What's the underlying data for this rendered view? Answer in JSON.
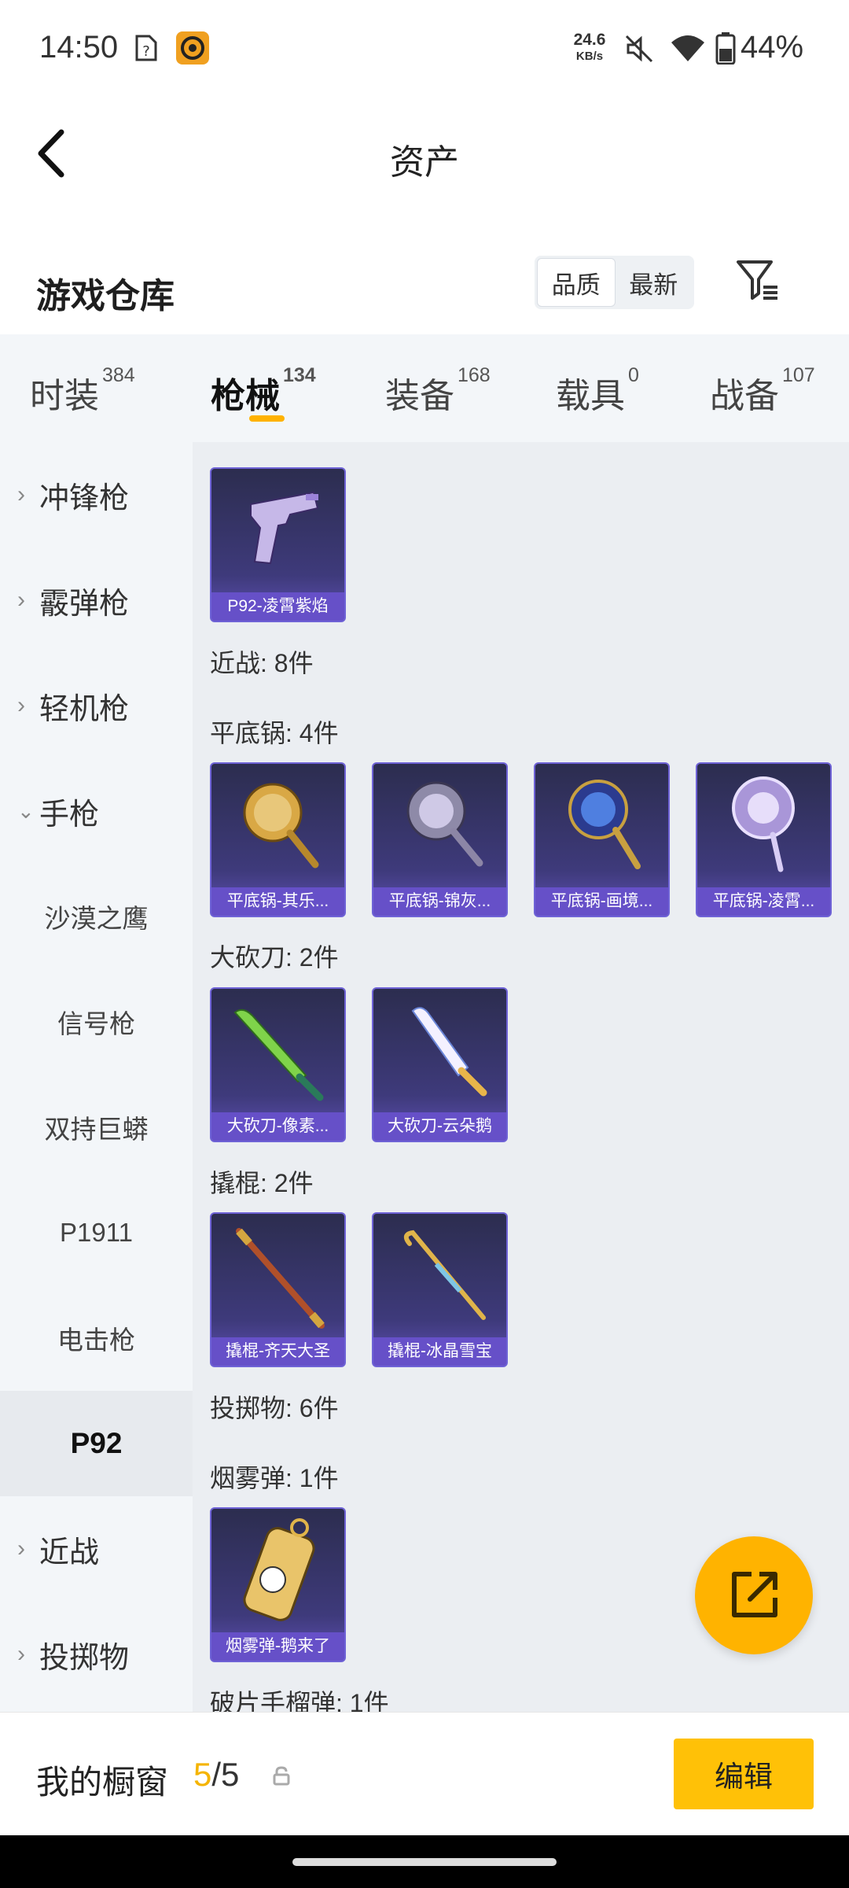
{
  "status_bar": {
    "time": "14:50",
    "net_speed_value": "24.6",
    "net_speed_unit": "KB/s",
    "battery": "44%",
    "icons": [
      "sim-question-icon",
      "app-notification-icon",
      "mute-icon",
      "wifi-icon",
      "battery-icon"
    ]
  },
  "header": {
    "title": "资产"
  },
  "warehouse": {
    "title": "游戏仓库",
    "sort_quality": "品质",
    "sort_latest": "最新"
  },
  "tabs": [
    {
      "label": "时装",
      "count": "384"
    },
    {
      "label": "枪械",
      "count": "134",
      "active": true
    },
    {
      "label": "装备",
      "count": "168"
    },
    {
      "label": "载具",
      "count": "0"
    },
    {
      "label": "战备",
      "count": "107"
    }
  ],
  "sidebar": [
    {
      "label": "冲锋枪",
      "type": "group",
      "expanded": false
    },
    {
      "label": "霰弹枪",
      "type": "group",
      "expanded": false
    },
    {
      "label": "轻机枪",
      "type": "group",
      "expanded": false
    },
    {
      "label": "手枪",
      "type": "group",
      "expanded": true
    },
    {
      "label": "沙漠之鹰",
      "type": "sub"
    },
    {
      "label": "信号枪",
      "type": "sub"
    },
    {
      "label": "双持巨蟒",
      "type": "sub"
    },
    {
      "label": "P1911",
      "type": "sub"
    },
    {
      "label": "电击枪",
      "type": "sub"
    },
    {
      "label": "P92",
      "type": "sub",
      "selected": true
    },
    {
      "label": "近战",
      "type": "group",
      "expanded": false
    },
    {
      "label": "投掷物",
      "type": "group",
      "expanded": false
    }
  ],
  "content": {
    "sections": [
      {
        "label": "近战: 8件"
      },
      {
        "label": "平底锅: 4件"
      },
      {
        "label": "大砍刀: 2件"
      },
      {
        "label": "撬棍: 2件"
      },
      {
        "label": "投掷物: 6件"
      },
      {
        "label": "烟雾弹: 1件"
      },
      {
        "label": "破片手榴弹: 1件"
      }
    ],
    "items": [
      {
        "caption": "P92-凌霄紫焰",
        "kind": "pistol"
      },
      {
        "caption": "平底锅-其乐...",
        "kind": "pan-gold"
      },
      {
        "caption": "平底锅-锦灰...",
        "kind": "pan-gray"
      },
      {
        "caption": "平底锅-画境...",
        "kind": "pan-blue"
      },
      {
        "caption": "平底锅-凌霄...",
        "kind": "pan-purple"
      },
      {
        "caption": "大砍刀-像素...",
        "kind": "machete-green"
      },
      {
        "caption": "大砍刀-云朵鹅",
        "kind": "machete-white"
      },
      {
        "caption": "撬棍-齐天大圣",
        "kind": "staff"
      },
      {
        "caption": "撬棍-冰晶雪宝",
        "kind": "crowbar"
      },
      {
        "caption": "烟雾弹-鹅来了",
        "kind": "smoke"
      }
    ]
  },
  "fab": {
    "icon": "share-export-icon"
  },
  "bottom_bar": {
    "title": "我的橱窗",
    "current": "5",
    "separator": "/",
    "total": "5",
    "edit_label": "编辑"
  },
  "colors": {
    "accent": "#ffb300",
    "card_caption": "#6650c8",
    "sidebar_bg": "#f3f6f9",
    "content_bg": "#ebeef2"
  }
}
